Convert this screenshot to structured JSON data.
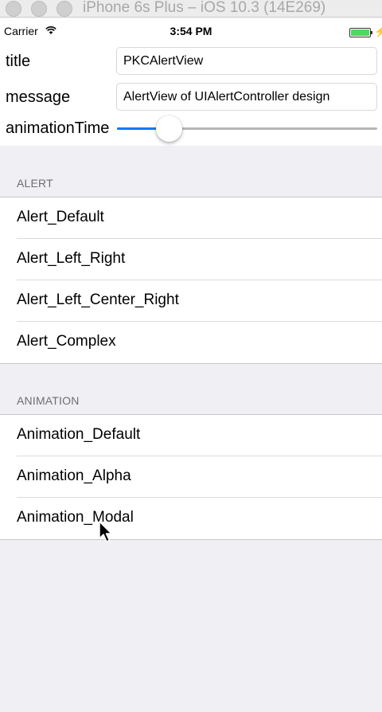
{
  "window": {
    "title": "iPhone 6s Plus – iOS 10.3 (14E269)"
  },
  "status_bar": {
    "carrier": "Carrier",
    "time": "3:54 PM",
    "battery_level": 1.0,
    "battery_color": "#4cd964"
  },
  "form": {
    "title_label": "title",
    "title_value": "PKCAlertView",
    "message_label": "message",
    "message_value": "AlertView of UIAlertController design",
    "animation_label": "animationTime",
    "animation_value": 0.2
  },
  "sections": [
    {
      "header": "ALERT",
      "items": [
        "Alert_Default",
        "Alert_Left_Right",
        "Alert_Left_Center_Right",
        "Alert_Complex"
      ]
    },
    {
      "header": "ANIMATION",
      "items": [
        "Animation_Default",
        "Animation_Alpha",
        "Animation_Modal"
      ]
    }
  ],
  "colors": {
    "accent": "#007aff",
    "group_background": "#efeff4",
    "header_text": "#6d6d72"
  }
}
